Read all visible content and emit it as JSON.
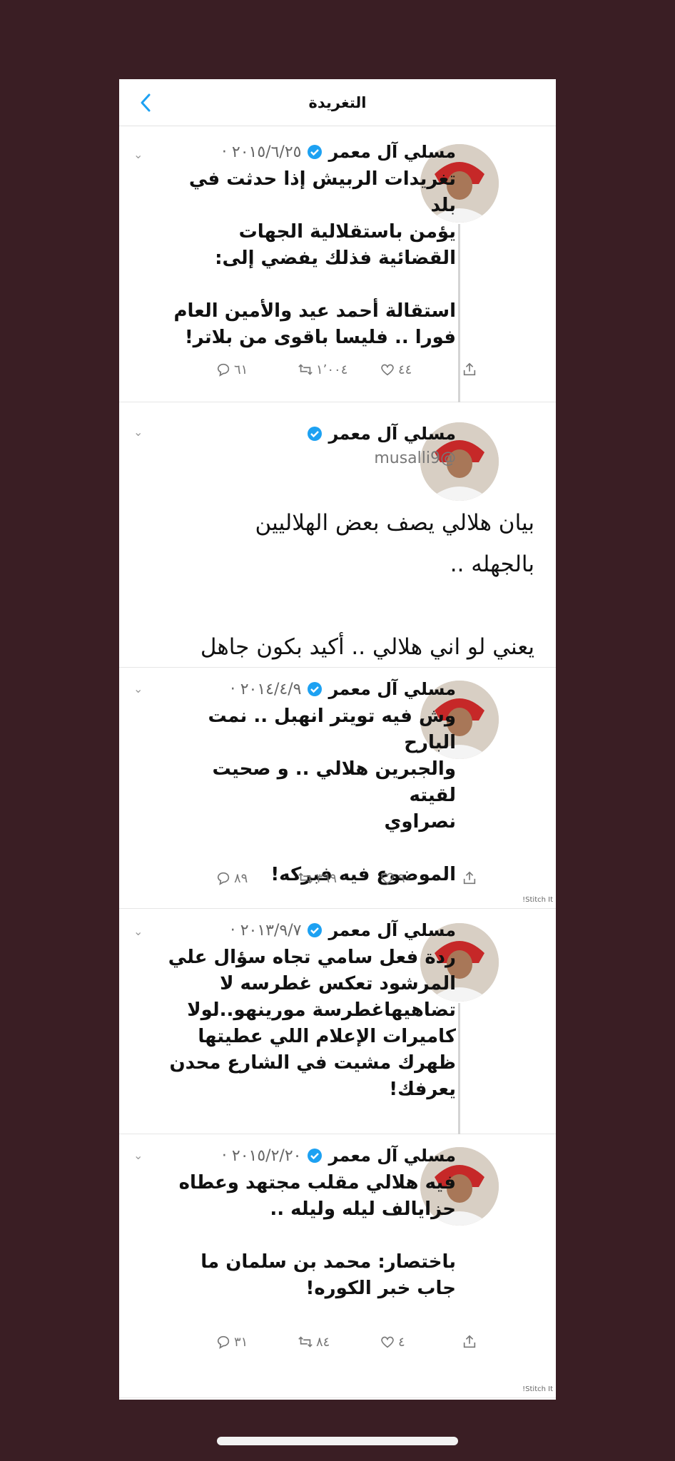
{
  "header": {
    "title": "التغريدة",
    "back_icon": "chevron-left-icon"
  },
  "colors": {
    "background": "#3a1e24",
    "accent": "#1da1f2"
  },
  "tweets": [
    {
      "name": "مسلي آل معمر",
      "date": "٢٠١٥/٦/٢٥ ·",
      "text": "تغريدات الربيش إذا حدثت في بلد\nيؤمن باستقلالية الجهات\nالقضائية فذلك يفضي إلى:\n\nاستقالة أحمد عيد والأمين العام\nفورا .. فليسا باقوى من بلاتر!",
      "replies": "٦١",
      "retweets": "١٬٠٠٤",
      "likes": "٤٤"
    },
    {
      "name": "مسلي آل معمر",
      "handle": "@musalli9",
      "text": "بيان هلالي يصف بعض الهلاليين\nبالجهله ..\n\nيعني لو اني هلالي .. أكيد بكون جاهل"
    },
    {
      "name": "مسلي آل معمر",
      "date": "٢٠١٤/٤/٩ ·",
      "text": "وش فيه تويتر انهبل .. نمت البارح\nوالجبرين هلالي .. و صحيت لقيته\nنصراوي\n\nالموضوع فيه فبركه!",
      "replies": "٨٩",
      "retweets": "٣٦٩",
      "likes": "٩٠",
      "stitch": "Stitch It!"
    },
    {
      "name": "مسلي آل معمر",
      "date": "٢٠١٣/٩/٧ ·",
      "text": "ردة فعل سامي تجاه سؤال علي\nالمرشود تعكس غطرسه لا\nتضاهيهاغطرسة مورينهو..لولا\nكاميرات الإعلام اللي عطيتها\nظهرك مشيت في الشارع محدن\nيعرفك!"
    },
    {
      "name": "مسلي آل معمر",
      "date": "٢٠١٥/٢/٢٠ ·",
      "text": "فيه هلالي مقلب مجتهد وعطاه\nحزايالف ليله وليله ..\n\nباختصار: محمد بن سلمان ما\nجاب خبر الكوره!",
      "replies": "٣١",
      "retweets": "٨٤",
      "likes": "٤",
      "stitch": "Stitch It!"
    }
  ]
}
